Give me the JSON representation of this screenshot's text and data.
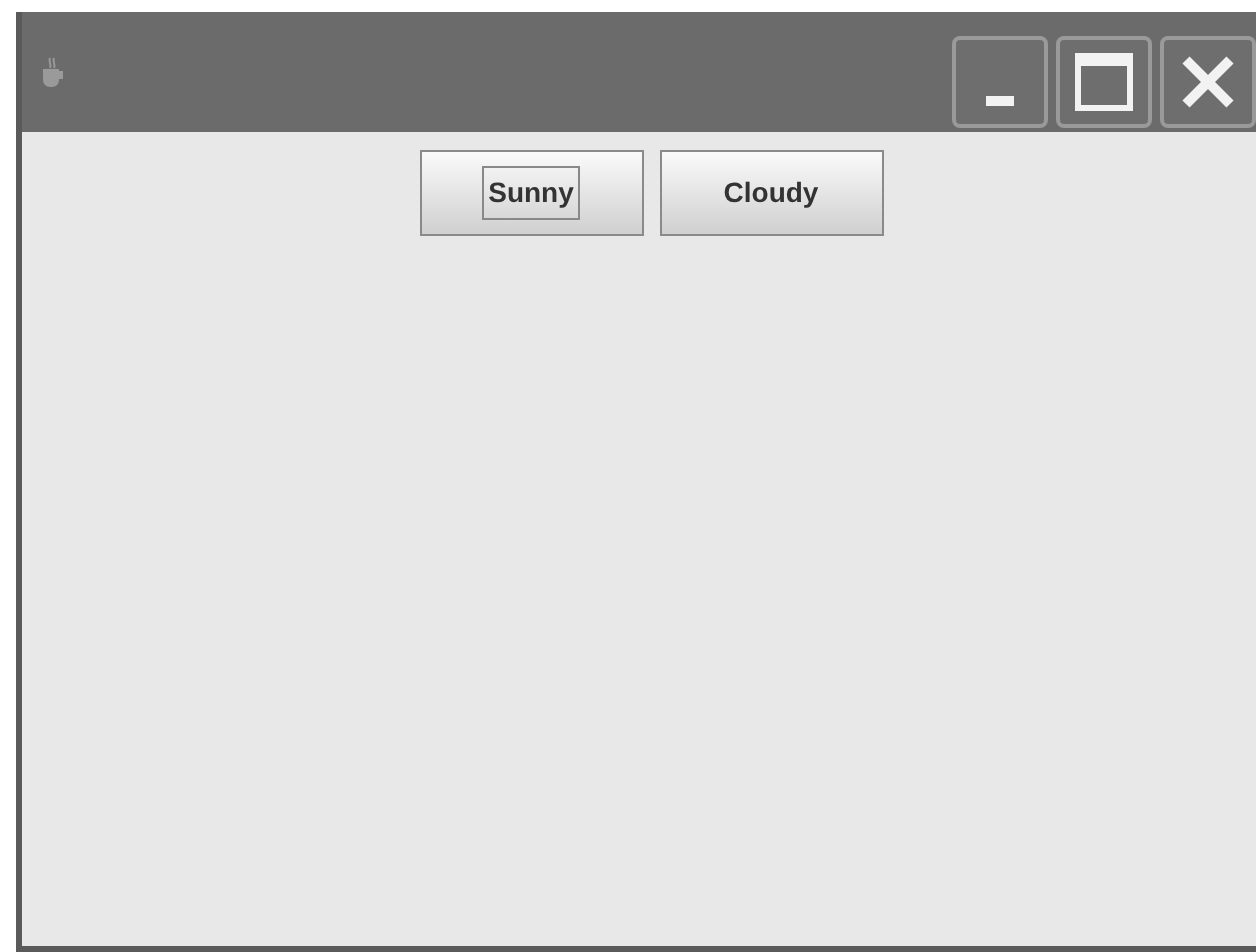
{
  "window": {
    "title_buttons": [
      {
        "kind": "minimize"
      },
      {
        "kind": "maximize"
      },
      {
        "kind": "close"
      }
    ]
  },
  "buttons": [
    {
      "label": "Sunny",
      "focused": true
    },
    {
      "label": "Cloudy",
      "focused": false
    }
  ]
}
